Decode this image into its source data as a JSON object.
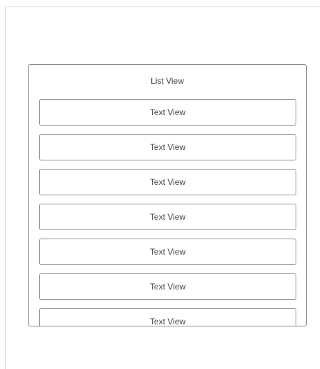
{
  "list_view": {
    "title": "List View",
    "items": [
      {
        "label": "Text View"
      },
      {
        "label": "Text View"
      },
      {
        "label": "Text View"
      },
      {
        "label": "Text View"
      },
      {
        "label": "Text View"
      },
      {
        "label": "Text View"
      },
      {
        "label": "Text View"
      }
    ]
  }
}
